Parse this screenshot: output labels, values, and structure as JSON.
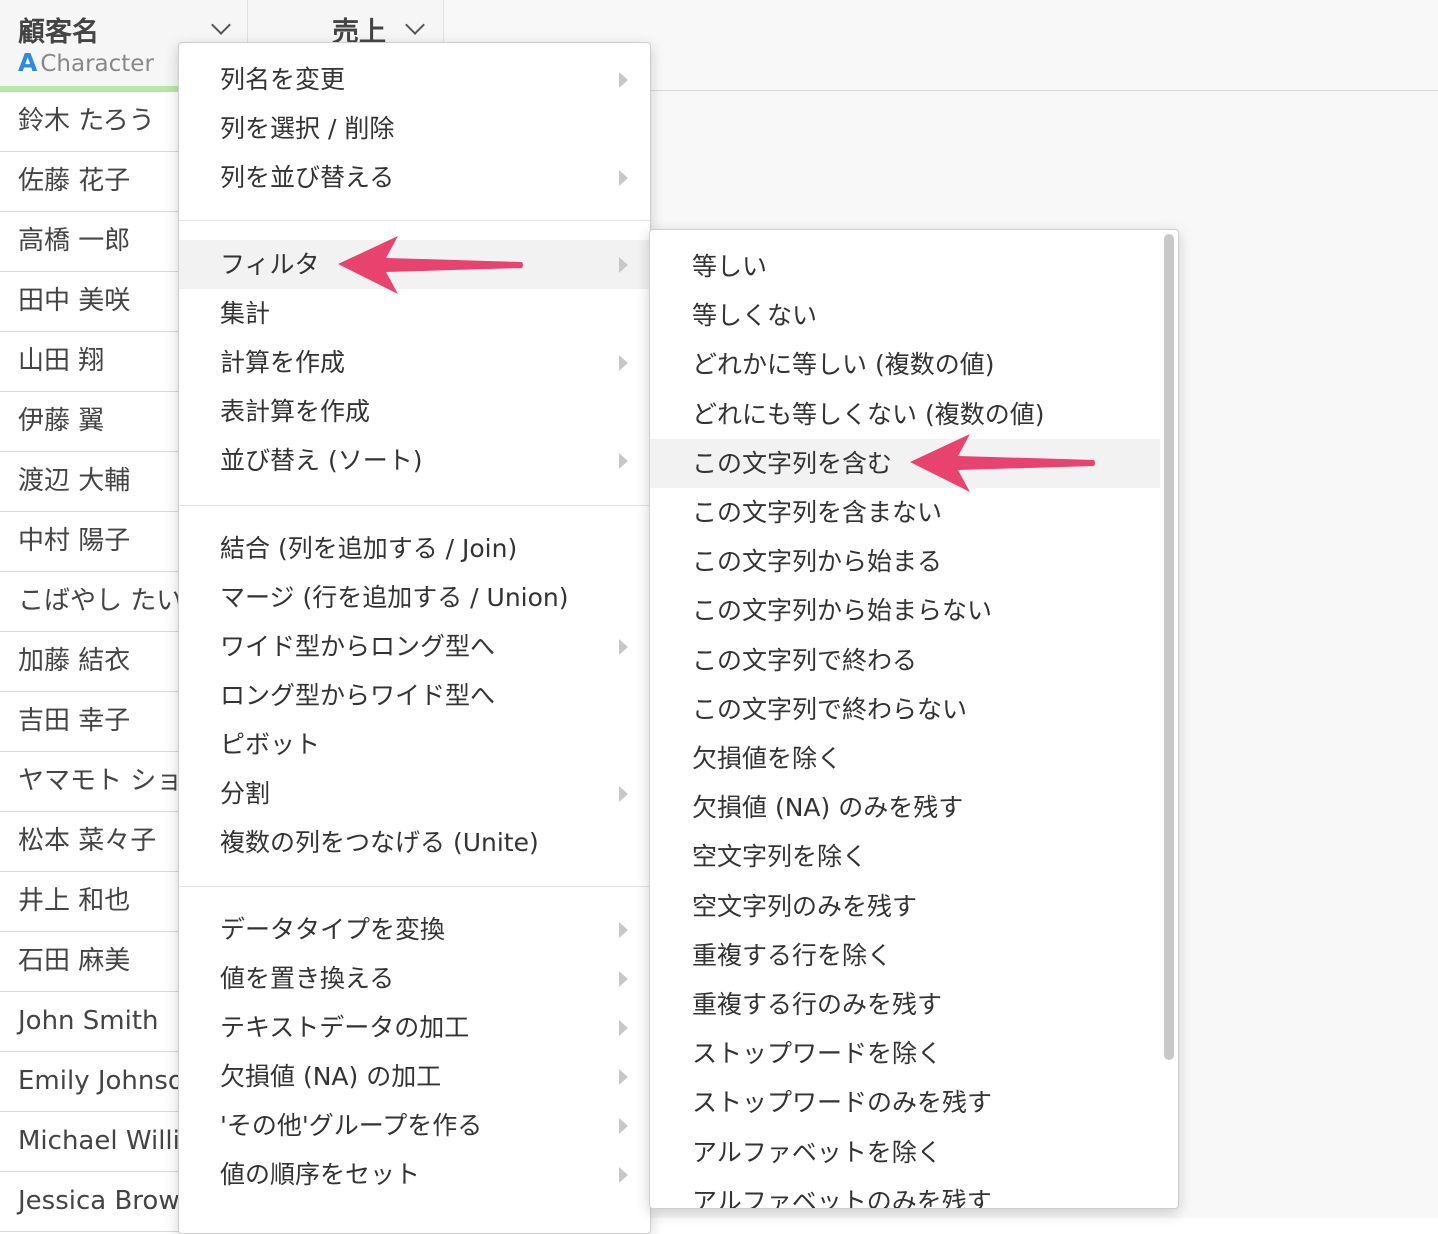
{
  "table": {
    "columns": [
      {
        "title": "顧客名",
        "type_icon": "A",
        "type_label": "Character"
      },
      {
        "title": "売上"
      }
    ],
    "rows": [
      "鈴木 たろう",
      "佐藤 花子",
      "高橋 一郎",
      "田中 美咲",
      "山田 翔",
      "伊藤 翼",
      "渡辺 大輔",
      "中村 陽子",
      "こばやし たい",
      "加藤 結衣",
      "吉田 幸子",
      "ヤマモト ショ",
      "松本 菜々子",
      "井上 和也",
      "石田 麻美",
      "John Smith",
      "Emily Johnso",
      "Michael Willia",
      "Jessica Brow"
    ]
  },
  "main_menu": {
    "items": [
      {
        "label": "列名を変更",
        "submenu": true
      },
      {
        "label": "列を選択 / 削除",
        "submenu": false
      },
      {
        "label": "列を並び替える",
        "submenu": true
      },
      {
        "label": "フィルタ",
        "submenu": true
      },
      {
        "label": "集計",
        "submenu": false
      },
      {
        "label": "計算を作成",
        "submenu": true
      },
      {
        "label": "表計算を作成",
        "submenu": false
      },
      {
        "label": "並び替え (ソート)",
        "submenu": true
      },
      {
        "label": "結合 (列を追加する / Join)",
        "submenu": false
      },
      {
        "label": "マージ (行を追加する / Union)",
        "submenu": false
      },
      {
        "label": "ワイド型からロング型へ",
        "submenu": true
      },
      {
        "label": "ロング型からワイド型へ",
        "submenu": false
      },
      {
        "label": "ピボット",
        "submenu": false
      },
      {
        "label": "分割",
        "submenu": true
      },
      {
        "label": "複数の列をつなげる (Unite)",
        "submenu": false
      },
      {
        "label": "データタイプを変換",
        "submenu": true
      },
      {
        "label": "値を置き換える",
        "submenu": true
      },
      {
        "label": "テキストデータの加工",
        "submenu": true
      },
      {
        "label": "欠損値 (NA) の加工",
        "submenu": true
      },
      {
        "label": "'その他'グループを作る",
        "submenu": true
      },
      {
        "label": "値の順序をセット",
        "submenu": true
      }
    ]
  },
  "filter_submenu": {
    "items": [
      "等しい",
      "等しくない",
      "どれかに等しい (複数の値)",
      "どれにも等しくない (複数の値)",
      "この文字列を含む",
      "この文字列を含まない",
      "この文字列から始まる",
      "この文字列から始まらない",
      "この文字列で終わる",
      "この文字列で終わらない",
      "欠損値を除く",
      "欠損値 (NA) のみを残す",
      "空文字列を除く",
      "空文字列のみを残す",
      "重複する行を除く",
      "重複する行のみを残す",
      "ストップワードを除く",
      "ストップワードのみを残す",
      "アルファベットを除く",
      "アルファベットのみを残す"
    ]
  },
  "colors": {
    "pointer": "#e8436e",
    "type_icon": "#2f8bd8",
    "column_bar": "#b7e8a4"
  }
}
